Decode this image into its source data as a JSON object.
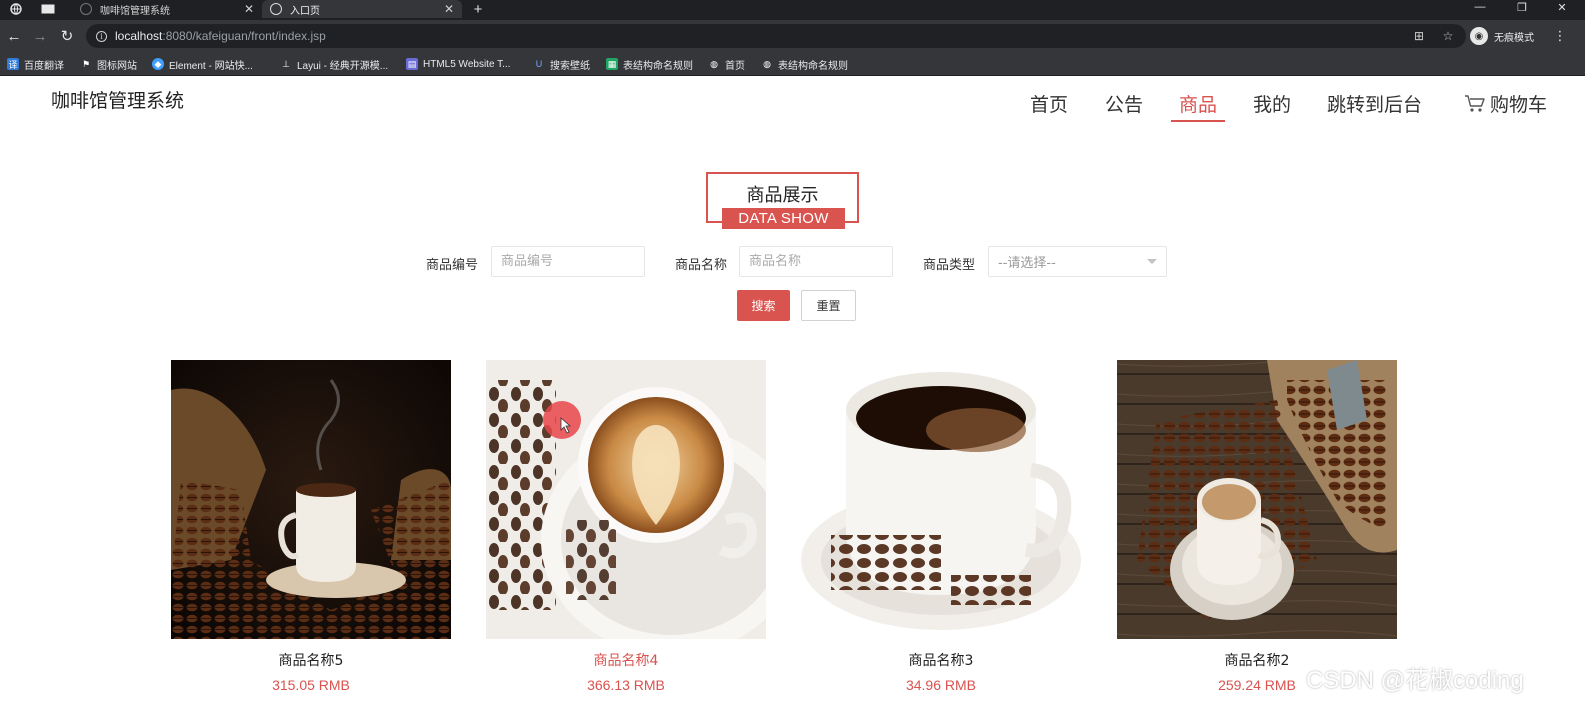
{
  "browser": {
    "tabs": [
      {
        "title": "咖啡馆管理系统",
        "active": false
      },
      {
        "title": "入口页",
        "active": true
      }
    ],
    "url_host": "localhost",
    "url_rest": ":8080/kafeiguan/front/index.jsp",
    "profile_label": "无痕模式",
    "bookmarks": [
      {
        "label": "百度翻译",
        "icon": "translate-icon"
      },
      {
        "label": "图标网站",
        "icon": "flag-icon"
      },
      {
        "label": "Element - 网站快...",
        "icon": "element-icon"
      },
      {
        "label": "Layui - 经典开源模...",
        "icon": "layui-icon"
      },
      {
        "label": "HTML5 Website T...",
        "icon": "html5-icon"
      },
      {
        "label": "搜索壁纸",
        "icon": "wallpaper-icon"
      },
      {
        "label": "表结构命名规则",
        "icon": "sheet-icon"
      },
      {
        "label": "首页",
        "icon": "globe-icon"
      },
      {
        "label": "表结构命名规则",
        "icon": "globe-icon"
      }
    ]
  },
  "site": {
    "title": "咖啡馆管理系统",
    "nav": [
      {
        "label": "首页",
        "active": false
      },
      {
        "label": "公告",
        "active": false
      },
      {
        "label": "商品",
        "active": true
      },
      {
        "label": "我的",
        "active": false
      },
      {
        "label": "跳转到后台",
        "active": false
      },
      {
        "label": "购物车",
        "active": false,
        "icon": "cart-icon"
      }
    ]
  },
  "section": {
    "title_cn": "商品展示",
    "title_en": "DATA SHOW"
  },
  "filters": {
    "code_label": "商品编号",
    "code_placeholder": "商品编号",
    "name_label": "商品名称",
    "name_placeholder": "商品名称",
    "type_label": "商品类型",
    "type_value": "--请选择--",
    "search_label": "搜索",
    "reset_label": "重置"
  },
  "products": [
    {
      "name": "商品名称5",
      "price": "315.05 RMB"
    },
    {
      "name": "商品名称4",
      "price": "366.13 RMB"
    },
    {
      "name": "商品名称3",
      "price": "34.96 RMB"
    },
    {
      "name": "商品名称2",
      "price": "259.24 RMB"
    }
  ],
  "colors": {
    "accent": "#d9534f",
    "chrome_dark": "#35363a"
  },
  "watermark": "CSDN @花椒coding"
}
